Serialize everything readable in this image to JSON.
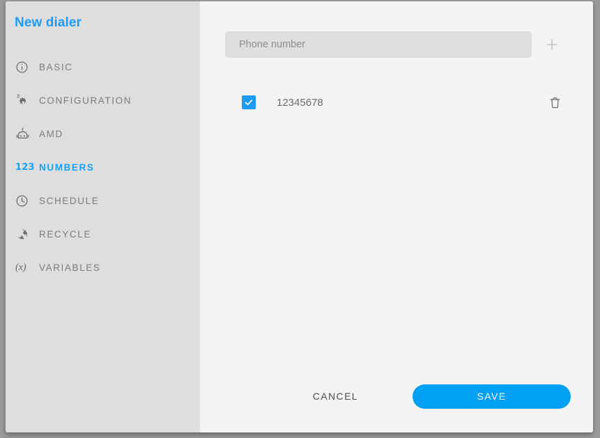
{
  "dialog": {
    "title": "New dialer"
  },
  "sidebar": {
    "items": [
      {
        "label": "BASIC",
        "icon": "info-circle-icon",
        "active": false
      },
      {
        "label": "CONFIGURATION",
        "icon": "gears-icon",
        "active": false
      },
      {
        "label": "AMD",
        "icon": "robot-icon",
        "active": false
      },
      {
        "label": "NUMBERS",
        "icon": "123-icon",
        "active": true
      },
      {
        "label": "SCHEDULE",
        "icon": "clock-icon",
        "active": false
      },
      {
        "label": "RECYCLE",
        "icon": "recycle-icon",
        "active": false
      },
      {
        "label": "VARIABLES",
        "icon": "variable-x-icon",
        "active": false
      }
    ],
    "numbers_badge": "123"
  },
  "main": {
    "phone_input": {
      "placeholder": "Phone number",
      "value": ""
    },
    "add_button_label": "+",
    "numbers": [
      {
        "value": "12345678",
        "checked": true
      }
    ]
  },
  "footer": {
    "cancel_label": "CANCEL",
    "save_label": "SAVE"
  },
  "colors": {
    "accent": "#1e9cf5",
    "save_button": "#02a0f5",
    "sidebar_bg": "#dedede",
    "main_bg": "#f4f4f4",
    "input_bg": "#dfdfdf",
    "label_gray": "#7b7b7b"
  }
}
